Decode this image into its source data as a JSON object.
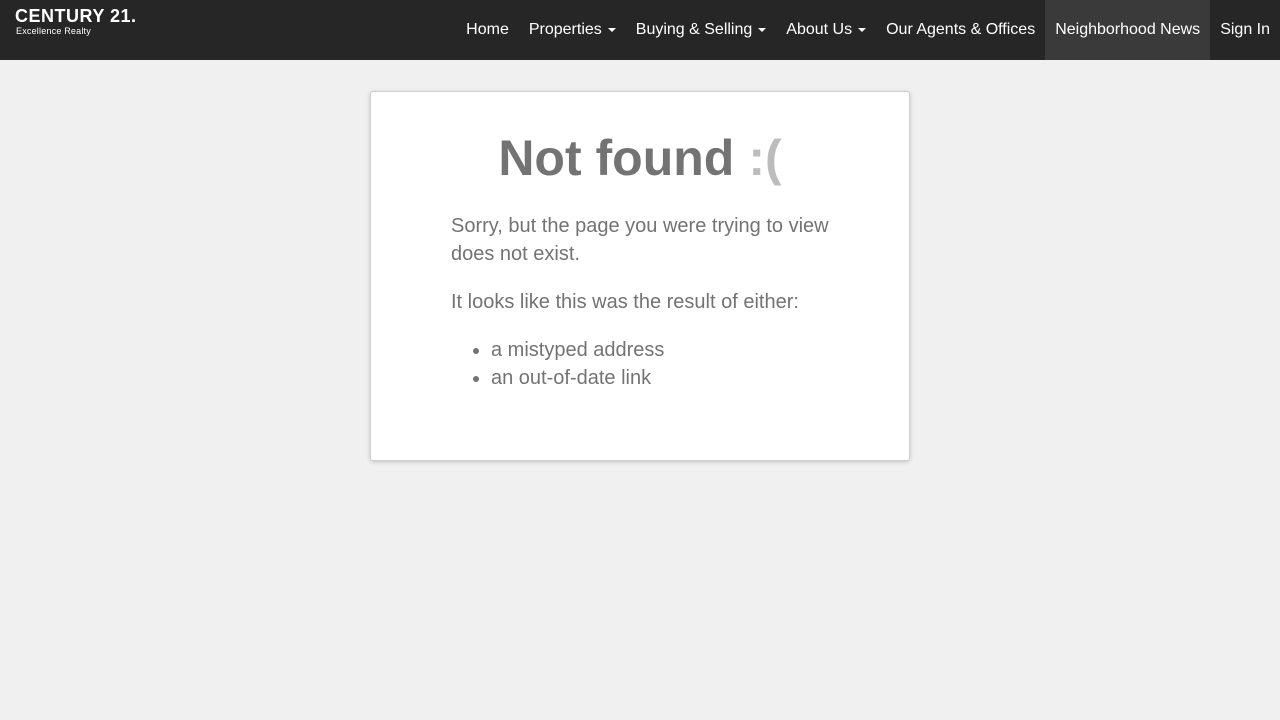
{
  "header": {
    "logo": {
      "brand": "CENTURY 21.",
      "tagline": "Excellence Realty"
    },
    "nav": [
      {
        "label": "Home",
        "dropdown": false
      },
      {
        "label": "Properties",
        "dropdown": true
      },
      {
        "label": "Buying & Selling",
        "dropdown": true
      },
      {
        "label": "About Us",
        "dropdown": true
      },
      {
        "label": "Our Agents & Offices",
        "dropdown": false
      },
      {
        "label": "Neighborhood News",
        "dropdown": false,
        "active": true
      },
      {
        "label": "Sign In",
        "dropdown": false
      }
    ]
  },
  "error_card": {
    "title": "Not found",
    "face": ":(",
    "message": "Sorry, but the page you were trying to view does not exist.",
    "reason_intro": "It looks like this was the result of either:",
    "reasons": [
      "a mistyped address",
      "an out-of-date link"
    ]
  },
  "colors": {
    "navbar": "#262626",
    "active_nav": "#3a3a3a",
    "page_background": "#f0f0f0",
    "text": "#737373",
    "face": "#bcbcbc"
  }
}
